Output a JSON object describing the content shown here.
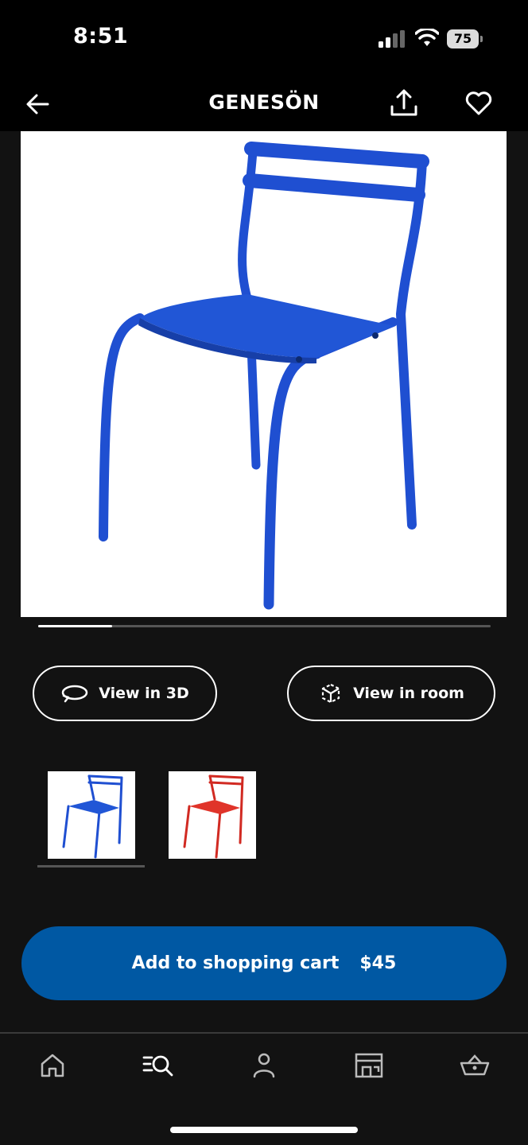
{
  "status": {
    "time": "8:51",
    "battery": "75"
  },
  "header": {
    "title": "GENESÖN"
  },
  "product": {
    "image_alt": "GENESÖN chair, blue"
  },
  "actions": {
    "view_3d": "View in 3D",
    "view_room": "View in room"
  },
  "variants": [
    {
      "color_name": "Blue",
      "hex": "#1f4fd1",
      "selected": true
    },
    {
      "color_name": "Red",
      "hex": "#d12a22",
      "selected": false
    }
  ],
  "carousel": {
    "current": 1
  },
  "cart": {
    "label": "Add to shopping cart",
    "price": "$45"
  },
  "nav": [
    {
      "name": "home-icon"
    },
    {
      "name": "search-icon",
      "selected": true
    },
    {
      "name": "profile-icon"
    },
    {
      "name": "store-icon"
    },
    {
      "name": "basket-icon"
    }
  ],
  "colors": {
    "accent": "#0058a3",
    "background": "#121212"
  }
}
